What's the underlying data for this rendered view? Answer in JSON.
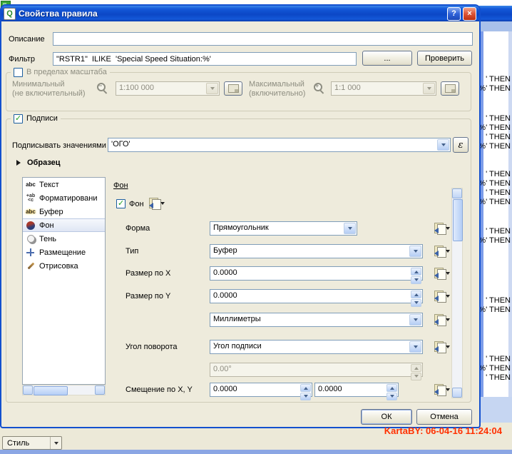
{
  "window": {
    "title": "Свойства правила",
    "app_icon_letter": "Q",
    "help_glyph": "?",
    "close_glyph": "×"
  },
  "description_row": {
    "label": "Описание",
    "value": ""
  },
  "filter_row": {
    "label": "Фильтр",
    "value": "\"RSTR1\"  ILIKE  'Special Speed Situation:%'",
    "browse_label": "...",
    "test_label": "Проверить"
  },
  "scale_group": {
    "title": "В пределах масштаба",
    "checked": false,
    "min": {
      "label_line1": "Минимальный",
      "label_line2": "(не включительный)",
      "value": "1:100 000"
    },
    "max": {
      "label_line1": "Максимальный",
      "label_line2": "(включительно)",
      "value": "1:1 000"
    }
  },
  "labels_group": {
    "title": "Подписи",
    "checked": true,
    "label_with": {
      "label": "Подписывать значениями",
      "value": "'ОГО'",
      "expression_button_glyph": "ε"
    },
    "sample_title": "Образец"
  },
  "style_list": {
    "selected_index": 3,
    "items": [
      {
        "label": "Текст",
        "icon": "text-icon"
      },
      {
        "label": "Форматировани",
        "icon": "formatting-icon"
      },
      {
        "label": "Буфер",
        "icon": "buffer-icon"
      },
      {
        "label": "Фон",
        "icon": "background-icon"
      },
      {
        "label": "Тень",
        "icon": "shadow-icon"
      },
      {
        "label": "Размещение",
        "icon": "placement-icon"
      },
      {
        "label": "Отрисовка",
        "icon": "rendering-icon"
      }
    ]
  },
  "background_panel": {
    "header": "Фон",
    "enable_label": "Фон",
    "enabled": true,
    "rows": [
      {
        "label": "Форма",
        "value": "Прямоугольник",
        "control": "combo",
        "has_override": true
      },
      {
        "label": "Тип",
        "value": "Буфер",
        "control": "combo",
        "has_override": true
      },
      {
        "label": "Размер по X",
        "value": "0.0000",
        "control": "spin",
        "has_override": true
      },
      {
        "label": "Размер по Y",
        "value": "0.0000",
        "control": "spin",
        "has_override": true
      },
      {
        "label": "",
        "value": "Миллиметры",
        "control": "combo",
        "has_override": true
      },
      {
        "label": "Угол поворота",
        "value": "Угол подписи",
        "control": "combo",
        "has_override": true
      },
      {
        "label": "",
        "value": "0.00°",
        "control": "spin-disabled",
        "has_override": false
      },
      {
        "label": "Смещение по X, Y",
        "value": "0.0000",
        "value2": "0.0000",
        "control": "spin-pair",
        "has_override": true
      }
    ]
  },
  "dialog_buttons": {
    "ok": "ОК",
    "cancel": "Отмена"
  },
  "status_bar": {
    "style_button_label": "Стиль"
  },
  "watermark": {
    "text": "KartaBY: 06-04-16 11:24:04",
    "color": "#ff3000"
  },
  "background_window": {
    "fragments": [
      "' THEN",
      "@%' THEN",
      "' THEN",
      "@%' THEN",
      "' THEN",
      "@%' THEN",
      "' THEN",
      "@%' THEN",
      "' THEN",
      "@%' THEN",
      "' THEN",
      ";@%' THEN",
      "' THEN",
      "@%' THEN",
      "' THEN",
      "@%' THEN",
      "' THEN"
    ]
  }
}
